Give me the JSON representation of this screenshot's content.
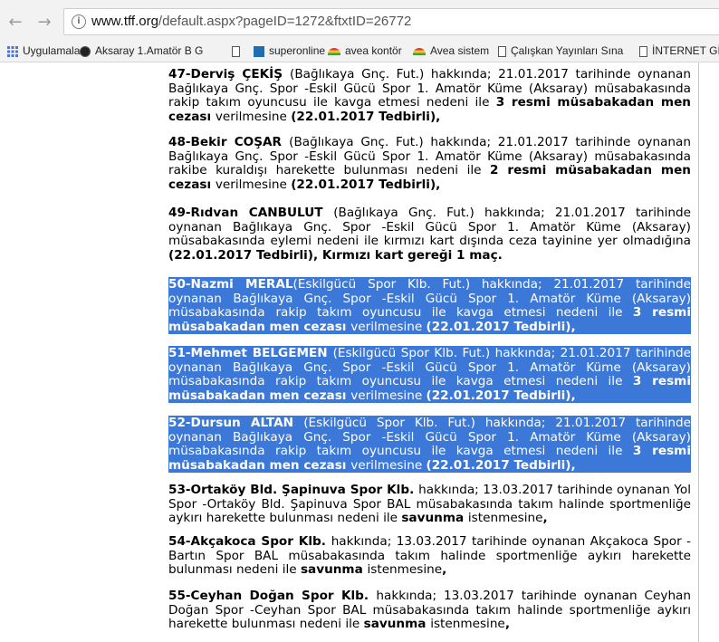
{
  "browser": {
    "back_icon": "arrow-left-icon",
    "forward_icon": "arrow-right-icon",
    "url_host": "www.tff.org",
    "url_path": "/default.aspx?pageID=1272&ftxtID=26772",
    "bookmarks": [
      {
        "label": "Uygulamalar",
        "icon": "apps-grid-icon"
      },
      {
        "label": "Aksaray 1.Amatör B G",
        "icon": "soccer-ball-icon"
      },
      {
        "label": "",
        "icon": "page-icon"
      },
      {
        "label": "superonline",
        "icon": "square-logo-icon"
      },
      {
        "label": "avea kontör",
        "icon": "rainbow-logo-icon"
      },
      {
        "label": "Avea sistem",
        "icon": "rainbow-logo-icon"
      },
      {
        "label": "Çalışkan Yayınları Sına",
        "icon": "page-icon"
      },
      {
        "label": "İNTERNET Gİ",
        "icon": "page-icon"
      }
    ]
  },
  "entries": [
    {
      "selected": false,
      "lines": [
        [
          [
            "b",
            "47-Derviş ÇEKİŞ "
          ],
          [
            "n",
            "(Bağlıkaya Gnç. Fut.) hakkında; 21.01.2017 tarihinde oynanan"
          ]
        ],
        [
          [
            "n",
            "Bağlıkaya Gnç. Spor -Eskil Gücü Spor 1. Amatör Küme (Aksaray) müsabakasında"
          ]
        ],
        [
          [
            "n",
            "rakip takım oyuncusu ile kavga etmesi nedeni ile "
          ],
          [
            "b",
            "3 resmi müsabakadan men"
          ]
        ],
        [
          [
            "b",
            "cezası "
          ],
          [
            "n",
            "verilmesine "
          ],
          [
            "b",
            "(22.01.2017 Tedbirli),"
          ]
        ]
      ]
    },
    {
      "selected": false,
      "lines": [
        [
          [
            "b",
            "48-Bekir COŞAR "
          ],
          [
            "n",
            "(Bağlıkaya Gnç. Fut.) hakkında; 21.01.2017 tarihinde oynanan"
          ]
        ],
        [
          [
            "n",
            "Bağlıkaya Gnç. Spor -Eskil Gücü Spor 1. Amatör Küme (Aksaray) müsabakasında"
          ]
        ],
        [
          [
            "n",
            "rakibe kuraldışı harekette bulunması nedeni ile "
          ],
          [
            "b",
            "2 resmi müsabakadan men cezası"
          ]
        ],
        [
          [
            "n",
            "verilmesine "
          ],
          [
            "b",
            "(22.01.2017 Tedbirli),"
          ]
        ]
      ]
    },
    {
      "selected": false,
      "lines": [
        [
          [
            "b",
            "49-Rıdvan CANBULUT "
          ],
          [
            "n",
            "(Bağlıkaya Gnç. Fut.) hakkında; 21.01.2017 tarihinde"
          ]
        ],
        [
          [
            "n",
            "oynanan Bağlıkaya Gnç. Spor -Eskil Gücü Spor 1. Amatör Küme (Aksaray)"
          ]
        ],
        [
          [
            "n",
            "müsabakasında eylemi nedeni ile kırmızı kart dışında ceza tayinine yer olmadığına"
          ]
        ],
        [
          [
            "b",
            "(22.01.2017 Tedbirli), Kırmızı kart gereği 1 maç."
          ]
        ]
      ]
    },
    {
      "selected": true,
      "lines": [
        [
          [
            "b",
            "50-Nazmi MERAL"
          ],
          [
            "n",
            "(Eskilgücü Spor Klb. Fut.) hakkında; 21.01.2017 tarihinde oynanan"
          ]
        ],
        [
          [
            "n",
            "Bağlıkaya Gnç. Spor -Eskil Gücü Spor 1. Amatör Küme (Aksaray) müsabakasında"
          ]
        ],
        [
          [
            "n",
            "rakip takım oyuncusu ile kavga etmesi nedeni ile "
          ],
          [
            "b",
            "3 resmi müsabakadan men"
          ]
        ],
        [
          [
            "b",
            "cezası "
          ],
          [
            "n",
            "verilmesine "
          ],
          [
            "b",
            "(22.01.2017 Tedbirli),"
          ]
        ]
      ]
    },
    {
      "selected": true,
      "lines": [
        [
          [
            "b",
            "51-Mehmet BELGEMEN "
          ],
          [
            "n",
            "(Eskilgücü Spor Klb. Fut.) hakkında; 21.01.2017 tarihinde"
          ]
        ],
        [
          [
            "n",
            "oynanan Bağlıkaya Gnç. Spor -Eskil Gücü Spor 1. Amatör Küme (Aksaray)"
          ]
        ],
        [
          [
            "n",
            "müsabakasında rakip takım oyuncusu ile kavga etmesi nedeni ile "
          ],
          [
            "b",
            "3 resmi"
          ]
        ],
        [
          [
            "b",
            "müsabakadan men cezası "
          ],
          [
            "n",
            "verilmesine "
          ],
          [
            "b",
            "(22.01.2017 Tedbirli),"
          ]
        ]
      ]
    },
    {
      "selected": true,
      "lines": [
        [
          [
            "b",
            "52-Dursun ALTAN "
          ],
          [
            "n",
            "(Eskilgücü Spor Klb. Fut.) hakkında; 21.01.2017 tarihinde"
          ]
        ],
        [
          [
            "n",
            "oynanan Bağlıkaya Gnç. Spor -Eskil Gücü Spor 1. Amatör Küme (Aksaray)"
          ]
        ],
        [
          [
            "n",
            "müsabakasında rakip takım oyuncusu ile kavga etmesi nedeni ile "
          ],
          [
            "b",
            "3 resmi"
          ]
        ],
        [
          [
            "b",
            "müsabakadan men cezası "
          ],
          [
            "n",
            "verilmesine "
          ],
          [
            "b",
            "(22.01.2017 Tedbirli),"
          ]
        ]
      ]
    },
    {
      "selected": false,
      "lines": [
        [
          [
            "b",
            "53-Ortaköy Bld. Şapinuva Spor Klb. "
          ],
          [
            "n",
            "hakkında; 13.03.2017 tarihinde oynanan Yol"
          ]
        ],
        [
          [
            "n",
            "Spor -Ortaköy Bld. Şapinuva Spor BAL müsabakasında takım halinde sportmenliğe"
          ]
        ],
        [
          [
            "n",
            "aykırı harekette bulunması nedeni ile "
          ],
          [
            "b",
            "savunma "
          ],
          [
            "n",
            "istenmesine"
          ],
          [
            "b",
            ","
          ]
        ]
      ]
    },
    {
      "selected": false,
      "lines": [
        [
          [
            "b",
            "54-Akçakoca Spor Klb. "
          ],
          [
            "n",
            "hakkında; 13.03.2017 tarihinde oynanan Akçakoca Spor -"
          ]
        ],
        [
          [
            "n",
            "Bartın Spor BAL müsabakasında takım halinde sportmenliğe aykırı harekette"
          ]
        ],
        [
          [
            "n",
            "bulunması nedeni ile "
          ],
          [
            "b",
            "savunma "
          ],
          [
            "n",
            "istenmesine"
          ],
          [
            "b",
            ","
          ]
        ]
      ]
    },
    {
      "selected": false,
      "lines": [
        [
          [
            "b",
            "55-Ceyhan Doğan Spor Klb. "
          ],
          [
            "n",
            "hakkında; 13.03.2017 tarihinde oynanan Ceyhan"
          ]
        ],
        [
          [
            "n",
            "Doğan Spor -Ceyhan Spor BAL müsabakasında takım halinde sportmenliğe aykırı"
          ]
        ],
        [
          [
            "n",
            "harekette bulunması nedeni ile "
          ],
          [
            "b",
            "savunma "
          ],
          [
            "n",
            "istenmesine"
          ],
          [
            "b",
            ","
          ]
        ]
      ]
    }
  ]
}
